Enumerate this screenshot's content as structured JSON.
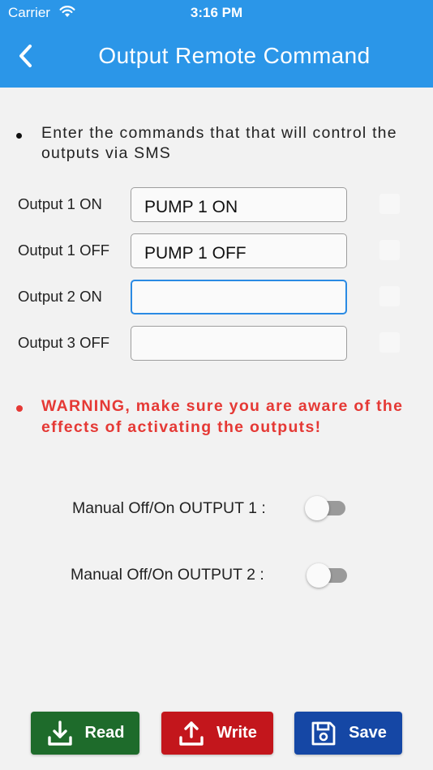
{
  "status_bar": {
    "carrier": "Carrier",
    "time": "3:16 PM"
  },
  "header": {
    "title": "Output Remote Command",
    "back_icon": "chevron-left-icon"
  },
  "info_text": "Enter the commands that that will control the outputs via SMS",
  "commands": [
    {
      "label": "Output 1 ON",
      "value": "PUMP 1 ON",
      "checked": false
    },
    {
      "label": "Output 1 OFF",
      "value": "PUMP 1 OFF",
      "checked": false
    },
    {
      "label": "Output 2 ON",
      "value": "",
      "checked": false,
      "focused": true
    },
    {
      "label": "Output 3 OFF",
      "value": "",
      "checked": false
    }
  ],
  "warning_text": "WARNING, make sure you are aware of the effects of activating the outputs!",
  "toggles": [
    {
      "label": "Manual Off/On OUTPUT 1 :",
      "on": false
    },
    {
      "label": "Manual Off/On OUTPUT 2 :",
      "on": false
    }
  ],
  "buttons": {
    "read": {
      "label": "Read",
      "icon": "download-icon",
      "color": "#1e6b2b"
    },
    "write": {
      "label": "Write",
      "icon": "upload-icon",
      "color": "#c3161c"
    },
    "save": {
      "label": "Save",
      "icon": "save-icon",
      "color": "#1547a5"
    }
  },
  "colors": {
    "appbar": "#2b96e8",
    "warning": "#e53935",
    "focus": "#2a8ae3"
  }
}
